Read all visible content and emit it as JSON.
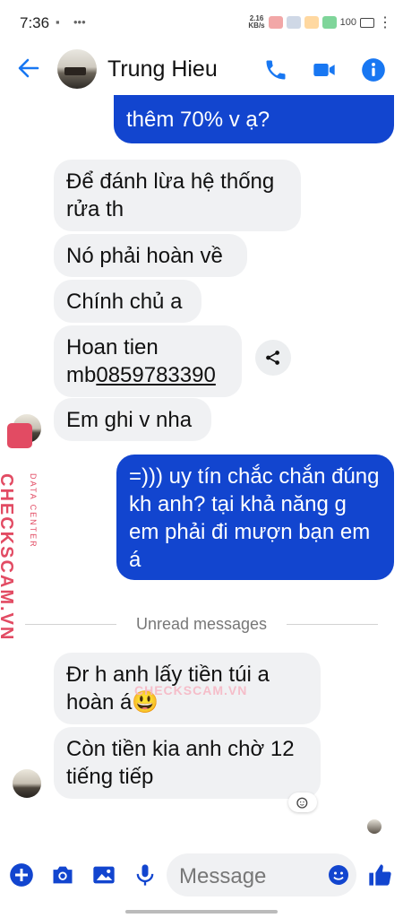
{
  "status_bar": {
    "time": "7:36",
    "net_speed_value": "2.16",
    "net_speed_unit": "KB/s",
    "battery": "100"
  },
  "header": {
    "contact_name": "Trung Hieu"
  },
  "messages": [
    {
      "side": "out",
      "text": "thêm 70% v ạ?"
    },
    {
      "side": "in",
      "text": "Để đánh lừa hệ thống rửa th"
    },
    {
      "side": "in",
      "text": "Nó phải hoàn về"
    },
    {
      "side": "in",
      "text": "Chính chủ a"
    },
    {
      "side": "in",
      "text_prefix": "Hoan tien mb",
      "link": "0859783390"
    },
    {
      "side": "in",
      "text": "Em ghi v nha"
    },
    {
      "side": "out",
      "text": "=))) uy tín chắc chắn đúng kh anh? tại khả năng g em phải đi mượn bạn em á"
    },
    {
      "side": "in",
      "text": "Đr h anh lấy tiền túi a hoàn á😃"
    },
    {
      "side": "in",
      "text": "Còn tiền kia anh chờ 12 tiếng tiếp"
    }
  ],
  "divider": {
    "label": "Unread messages"
  },
  "watermark": {
    "brand": "CHECKSCAM.VN",
    "sub": "DATA CENTER",
    "center": "CHECKSCAM.VN"
  },
  "composer": {
    "placeholder": "Message"
  },
  "colors": {
    "accent": "#1245cf",
    "incoming_bg": "#f0f1f3",
    "watermark": "#e24b63"
  }
}
